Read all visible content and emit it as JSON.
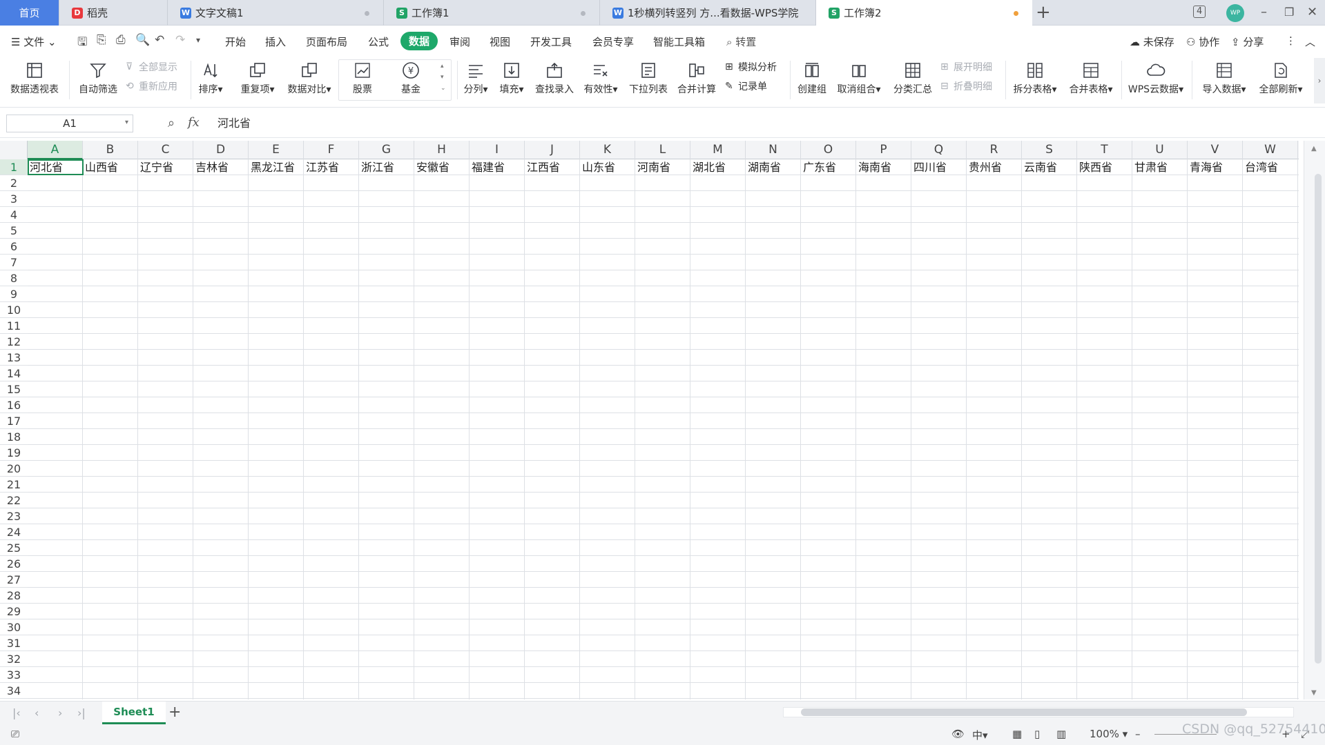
{
  "tabs": {
    "home": "首页",
    "items": [
      {
        "label": "稻壳",
        "icon": "daoke-icon",
        "color": "#e8383d"
      },
      {
        "label": "文字文稿1",
        "icon": "wps-writer-icon",
        "color": "#3a7be0"
      },
      {
        "label": "工作簿1",
        "icon": "wps-sheet-icon",
        "color": "#21a366"
      },
      {
        "label": "1秒横列转竖列 方...看数据-WPS学院",
        "icon": "wps-academy-icon",
        "color": "#3a7be0"
      },
      {
        "label": "工作簿2",
        "icon": "wps-sheet-icon",
        "color": "#21a366"
      }
    ],
    "new_tab": "+",
    "tab_count": "4",
    "avatar": "WP"
  },
  "menu": {
    "file": "文件",
    "items": [
      "开始",
      "插入",
      "页面布局",
      "公式",
      "数据",
      "审阅",
      "视图",
      "开发工具",
      "会员专享",
      "智能工具箱"
    ],
    "active": "数据",
    "search": "转置",
    "unsaved": "未保存",
    "collab": "协作",
    "share": "分享"
  },
  "ribbon": {
    "pivot": "数据透视表",
    "autofilter": "自动筛选",
    "show_all": "全部显示",
    "reapply": "重新应用",
    "sort": "排序",
    "duplicates": "重复项",
    "compare": "数据对比",
    "stock": "股票",
    "fund": "基金",
    "split": "分列",
    "fill": "填充",
    "lookup": "查找录入",
    "validity": "有效性",
    "dropdown": "下拉列表",
    "consolidate": "合并计算",
    "simulate": "模拟分析",
    "record": "记录单",
    "create_group": "创建组",
    "ungroup": "取消组合",
    "subtotal": "分类汇总",
    "expand": "展开明细",
    "collapse": "折叠明细",
    "split_table": "拆分表格",
    "merge_table": "合并表格",
    "cloud": "WPS云数据",
    "import": "导入数据",
    "refresh": "全部刷新"
  },
  "formula_bar": {
    "name_box": "A1",
    "fx": "fx",
    "content": "河北省"
  },
  "sheet": {
    "columns": [
      "A",
      "B",
      "C",
      "D",
      "E",
      "F",
      "G",
      "H",
      "I",
      "J",
      "K",
      "L",
      "M",
      "N",
      "O",
      "P",
      "Q",
      "R",
      "S",
      "T",
      "U",
      "V",
      "W"
    ],
    "rows": [
      "1",
      "2",
      "3",
      "4",
      "5",
      "6",
      "7",
      "8",
      "9",
      "10",
      "11",
      "12",
      "13",
      "14",
      "15",
      "16",
      "17",
      "18",
      "19",
      "20",
      "21",
      "22",
      "23",
      "24",
      "25",
      "26",
      "27",
      "28",
      "29",
      "30",
      "31",
      "32",
      "33",
      "34"
    ],
    "row1": [
      "河北省",
      "山西省",
      "辽宁省",
      "吉林省",
      "黑龙江省",
      "江苏省",
      "浙江省",
      "安徽省",
      "福建省",
      "江西省",
      "山东省",
      "河南省",
      "湖北省",
      "湖南省",
      "广东省",
      "海南省",
      "四川省",
      "贵州省",
      "云南省",
      "陕西省",
      "甘肃省",
      "青海省",
      "台湾省"
    ],
    "active_cell": "A1"
  },
  "sheet_tabs": {
    "active": "Sheet1",
    "add": "+"
  },
  "status": {
    "zoom": "100%"
  },
  "watermark": "CSDN @qq_52754410",
  "colors": {
    "accent": "#1e8c55",
    "home_tab": "#4a7fe3",
    "data_tab": "#1ea86a"
  }
}
